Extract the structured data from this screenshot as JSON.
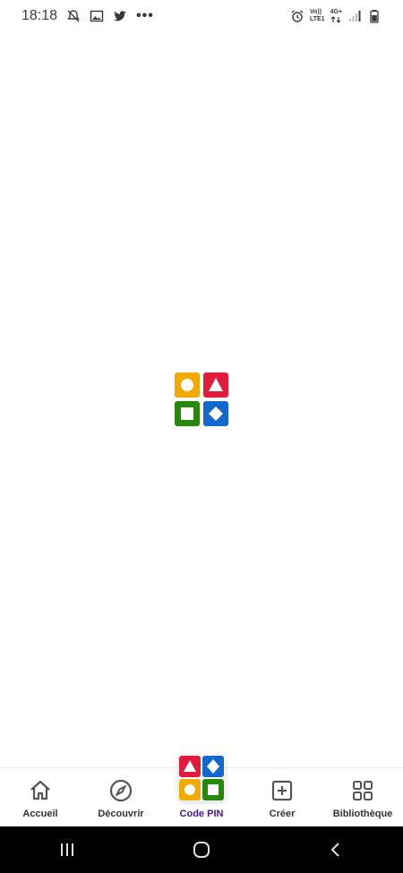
{
  "status_bar": {
    "time": "18:18",
    "volte_label": "Vo))",
    "lte_label": "LTE1",
    "net_label": "4G+",
    "more": "•••"
  },
  "logo": {
    "colors": {
      "yellow": "#f2a900",
      "red": "#e21b3c",
      "green": "#26890c",
      "blue": "#1368ce"
    }
  },
  "bottom_nav": {
    "items": [
      {
        "label": "Accueil",
        "icon": "home-icon"
      },
      {
        "label": "Découvrir",
        "icon": "compass-icon"
      },
      {
        "label": "Code PIN",
        "icon": "kahoot-pin-icon",
        "active": true
      },
      {
        "label": "Créer",
        "icon": "plus-square-icon"
      },
      {
        "label": "Bibliothèque",
        "icon": "grid-icon"
      }
    ],
    "active_color": "#46178f"
  }
}
